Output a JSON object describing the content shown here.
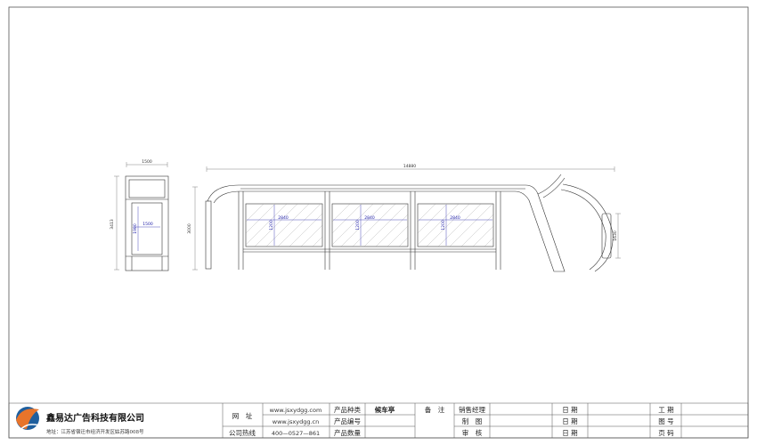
{
  "dimensions": {
    "side_width": "1500",
    "side_height": "3413",
    "side_inner_width": "1500",
    "side_inner_height": "1980",
    "front_total_length": "14880",
    "front_height": "3000",
    "panel_width": "2840",
    "panel_height": "1200",
    "right_panel_height": "1630"
  },
  "title_block": {
    "company_name": "鑫易达广告科技有限公司",
    "address": "地址：江苏省宿迁市经济开发区姑苏路008号",
    "website_label": "网　址",
    "website_1": "www.jsxydgg.com",
    "website_2": "www.jsxydgg.cn",
    "hotline_label": "公司热线",
    "hotline": "400—0527—861",
    "product_type_label": "产品种类",
    "product_type_value": "候车亭",
    "product_number_label": "产品编号",
    "product_qty_label": "产品数量",
    "remarks_label": "备　注",
    "sales_manager_label": "销售经理",
    "drawing_label": "制　图",
    "review_label": "审　核",
    "date_label_1": "日 期",
    "date_label_2": "日 期",
    "date_label_3": "日 期",
    "project_label": "工 期",
    "drawing_no_label": "图 号",
    "page_label": "页 码"
  },
  "colors": {
    "line": "#333333",
    "dimension": "#2222aa",
    "logo_blue": "#1f5f9e",
    "logo_orange": "#e8742a"
  }
}
